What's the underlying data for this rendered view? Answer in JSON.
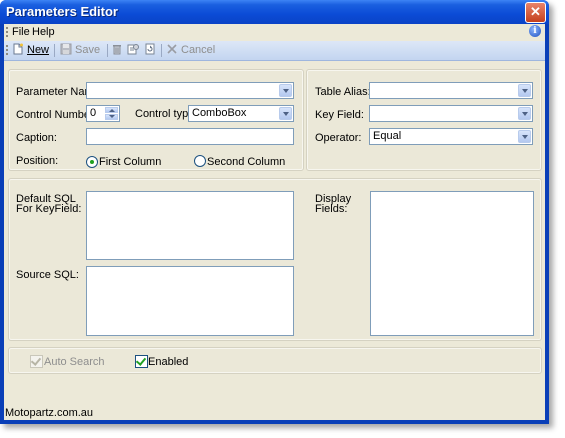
{
  "window": {
    "title": "Parameters Editor",
    "close": "✕"
  },
  "menu": {
    "file": "File",
    "help": "Help"
  },
  "toolbar": {
    "new": "New",
    "save": "Save",
    "cancel": "Cancel"
  },
  "params": {
    "parameter_name_label": "Parameter Name:",
    "control_number_label": "Control Number:",
    "control_number_value": "0",
    "control_type_label": "Control type:",
    "control_type_value": "ComboBox",
    "caption_label": "Caption:",
    "position_label": "Position:",
    "first_column": "First Column",
    "second_column": "Second Column"
  },
  "alias": {
    "table_alias_label": "Table Alias:",
    "key_field_label": "Key Field:",
    "operator_label": "Operator:",
    "operator_value": "Equal"
  },
  "sql": {
    "default_sql_label_1": "Default SQL",
    "default_sql_label_2": "For KeyField:",
    "source_sql_label": "Source SQL:",
    "display_fields_label_1": "Display",
    "display_fields_label_2": "Fields:"
  },
  "options": {
    "auto_search": "Auto Search",
    "enabled": "Enabled"
  },
  "status": {
    "text": "Motopartz.com.au"
  }
}
